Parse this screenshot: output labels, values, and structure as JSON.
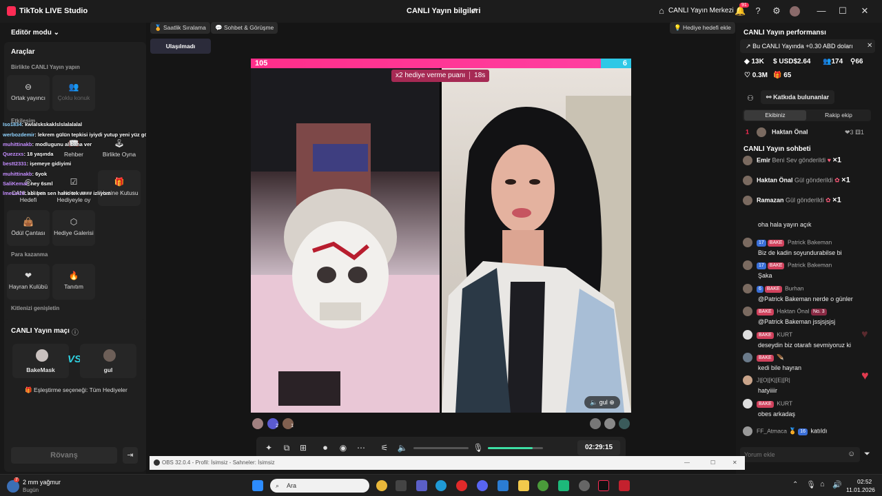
{
  "window": {
    "app_title": "TikTok LIVE Studio",
    "center_title": "CANLI Yayın bilgileri",
    "live_center": "CANLI Yayın Merkezi",
    "notif_count": "91"
  },
  "left": {
    "editor_mode": "Editör modu",
    "tools_title": "Araçlar",
    "section_together": "Birlikte CANLI Yayın yapın",
    "co_host": "Ortak yayıncı",
    "multi_guest": "Çoklu konuk",
    "section_engage": "Etkileşim",
    "guide": "Rehber",
    "play_together": "Birlikte Oyna",
    "live_goal": "CANLI Yayın Hedefi",
    "poll": "Anket ve Hediyeyle oy",
    "treasure": "Hazine Kutusu",
    "reward_bag": "Ödül Çantası",
    "gift_gallery": "Hediye Galerisi",
    "section_money": "Para kazanma",
    "fan_club": "Hayran Kulübü",
    "promote": "Tanıtım",
    "expand_audience": "Kitlenizi genişletin",
    "match_title": "CANLI Yayın maçı",
    "player1": "BakeMask",
    "player2": "gul",
    "vs": "VS",
    "match_option": "Eşleştirme seçeneği: Tüm Hediyeler",
    "rematch": "Rövanş"
  },
  "overlay_chat": [
    {
      "u": "Iso1834",
      "m": ": kwlalskskaklslslalalalal"
    },
    {
      "u": "werbozdemir",
      "m": ": lekrem gülün tepkisi iyiydi yutup yeni yüz görür izin al"
    },
    {
      "u": "muhittinakb",
      "m": ": modlugunu al bana ver"
    },
    {
      "u": "Quezzxs",
      "m": ": 18 yaşında"
    },
    {
      "u": "bestt2331",
      "m": ": işemeye gidiyimi"
    },
    {
      "u": "muhittinakb",
      "m": ": 6yok"
    },
    {
      "u": "SaliKemal",
      "m": ": ney 6sml"
    },
    {
      "u": "lmessi10",
      "m": ": abi ben sen haric tek #### izliyom"
    }
  ],
  "stage": {
    "chip1": "Saatlik Sıralama",
    "chip2": "Sohbet & Görüşme",
    "chip_goal": "Hediye hedefi ekle",
    "unreached": "Ulaşılmadı",
    "score_left": "105",
    "score_right": "6",
    "multiplier": "x2 hediye verme puanı",
    "timer": "18s",
    "guest_label": "gul",
    "duration": "02:29:15",
    "viewer_badge1": "2",
    "viewer_badge2": "1"
  },
  "right": {
    "perf_title": "CANLI Yayın performansı",
    "earning_note": "Bu CANLI Yayında +0.30 ABD doları",
    "diamonds": "13K",
    "usd": "USD$2.64",
    "viewers": "174",
    "new_followers": "66",
    "likes": "0.3M",
    "gifters": "65",
    "contributors": "Katkıda bulunanlar",
    "tab_team": "Ekibiniz",
    "tab_rival": "Rakip ekip",
    "rank1_pos": "1",
    "rank1_name": "Haktan Önal",
    "rank1_likes": "3",
    "rank1_gifts": "1",
    "chat_title": "CANLI Yayın sohbeti",
    "gifts": [
      {
        "name": "Emir",
        "text": "Beni Sev gönderildi",
        "count": "×1"
      },
      {
        "name": "Haktan Önal",
        "text": "Gül gönderildi",
        "count": "×1"
      },
      {
        "name": "Ramazan",
        "text": "Gül gönderildi",
        "count": "×1"
      }
    ],
    "comments": [
      {
        "badge": "",
        "club": "",
        "name": "",
        "text": "oha hala yayın açık"
      },
      {
        "badge": "17",
        "club": "BAKE",
        "name": "Patrick Bakeman",
        "text": "Biz de kadin soyundurabilse bi"
      },
      {
        "badge": "17",
        "club": "BAKE",
        "name": "Patrick Bakeman",
        "text": "Şaka"
      },
      {
        "badge": "6",
        "club": "BAKE",
        "name": "Burhan",
        "text": "@Patrick Bakeman nerde o günler"
      },
      {
        "badge": "",
        "club": "BAKE",
        "name": "Haktan Önal",
        "rank": "No. 3",
        "text": "@Patrick Bakeman jssjsjsjsj"
      },
      {
        "badge": "",
        "club": "BAKE",
        "name": "KURT",
        "text": "deseydin biz otarafı sevmiyoruz ki"
      },
      {
        "badge": "",
        "club": "BAKE",
        "name": "",
        "text": "kedi bile hayran"
      },
      {
        "badge": "",
        "club": "",
        "name": "J|[O|[K|[E|[R|",
        "text": "hatyiiiir"
      },
      {
        "badge": "",
        "club": "BAKE",
        "name": "KURT",
        "text": "obes arkadaş"
      }
    ],
    "joined_name": "FF_Atmaca",
    "joined_badge": "16",
    "joined_text": "katıldı",
    "input_placeholder": "Yorum ekle"
  },
  "obs": {
    "title": "OBS 32.0.4 - Profil: İsimsiz - Sahneler: İsimsiz"
  },
  "taskbar": {
    "weather": "2 mm yağmur",
    "weather_sub": "Bugün",
    "weather_badge": "7",
    "search": "Ara",
    "time": "02:52",
    "date": "11.01.2026"
  }
}
